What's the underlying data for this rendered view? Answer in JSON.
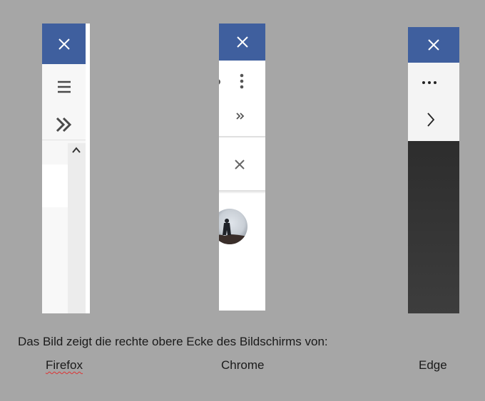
{
  "caption": "Das Bild zeigt die rechte obere Ecke des Bildschirms von:",
  "browsers": [
    {
      "name": "Firefox",
      "icons": [
        "close-icon",
        "hamburger-menu-icon",
        "double-chevron-right-icon",
        "chevron-up-icon"
      ]
    },
    {
      "name": "Chrome",
      "icons": [
        "close-icon",
        "vertical-dots-icon",
        "double-chevron-right-icon",
        "close-icon",
        "avatar"
      ]
    },
    {
      "name": "Edge",
      "icons": [
        "close-icon",
        "horizontal-dots-icon",
        "chevron-right-icon"
      ]
    }
  ],
  "colors": {
    "background": "#a6a6a6",
    "titlebar": "#3f5f9e"
  }
}
